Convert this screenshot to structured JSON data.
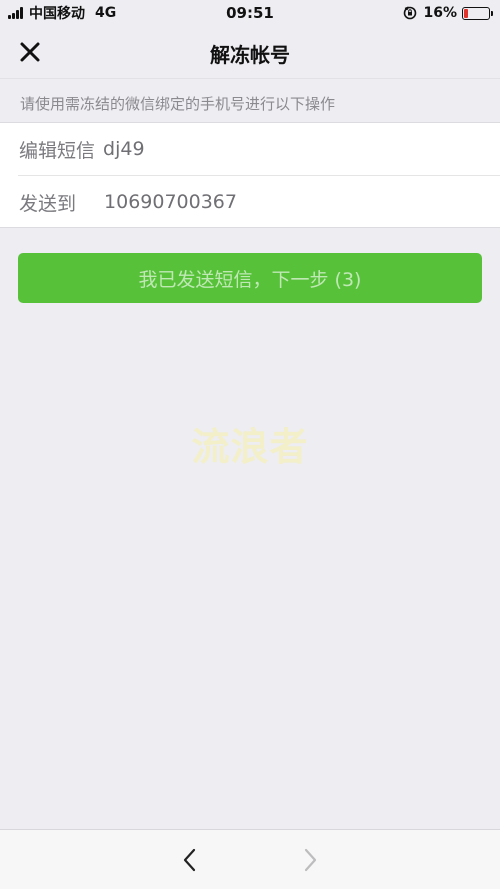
{
  "status_bar": {
    "carrier": "中国移动",
    "network": "4G",
    "time": "09:51",
    "battery_percent_label": "16%",
    "battery_level": 0.16,
    "battery_color": "#e0332c",
    "icons": [
      "signal-icon",
      "orientation-lock-icon",
      "battery-icon"
    ]
  },
  "nav": {
    "title": "解冻帐号",
    "close_icon": "close-icon"
  },
  "hint": {
    "text": "请使用需冻结的微信绑定的手机号进行以下操作"
  },
  "form": {
    "sms_label": "编辑短信",
    "sms_value": "dj49",
    "send_label": "发送到",
    "send_value": "10690700367"
  },
  "next_button": {
    "label": "我已发送短信，下一步 (3)",
    "color": "#57c13a"
  },
  "watermark": {
    "text": "流浪者"
  },
  "toolbar": {
    "back_icon": "chevron-left-icon",
    "forward_icon": "chevron-right-icon"
  }
}
